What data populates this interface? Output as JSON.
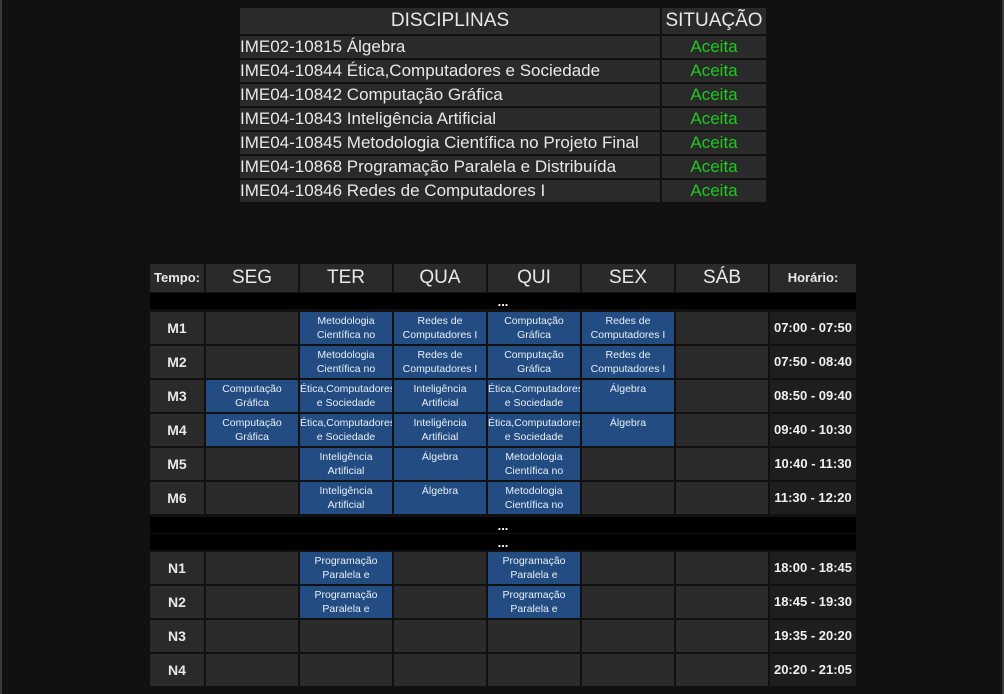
{
  "disciplines": {
    "header_name": "DISCIPLINAS",
    "header_status": "SITUAÇÃO",
    "rows": [
      {
        "name": "IME02-10815 Álgebra",
        "status": "Aceita"
      },
      {
        "name": "IME04-10844 Ética,Computadores e Sociedade",
        "status": "Aceita"
      },
      {
        "name": "IME04-10842 Computação Gráfica",
        "status": "Aceita"
      },
      {
        "name": "IME04-10843 Inteligência Artificial",
        "status": "Aceita"
      },
      {
        "name": "IME04-10845 Metodologia Científica no Projeto Final",
        "status": "Aceita"
      },
      {
        "name": "IME04-10868 Programação Paralela e Distribuída",
        "status": "Aceita"
      },
      {
        "name": "IME04-10846 Redes de Computadores I",
        "status": "Aceita"
      }
    ]
  },
  "schedule": {
    "tempo_label": "Tempo:",
    "horario_label": "Horário:",
    "days": [
      "SEG",
      "TER",
      "QUA",
      "QUI",
      "SEX",
      "SÁB"
    ],
    "gap_label": "...",
    "rows": [
      {
        "label": "M1",
        "time": "07:00 - 07:50",
        "cells": [
          "",
          "Metodologia Científica no",
          "Redes de Computadores I",
          "Computação Gráfica",
          "Redes de Computadores I",
          ""
        ]
      },
      {
        "label": "M2",
        "time": "07:50 - 08:40",
        "cells": [
          "",
          "Metodologia Científica no",
          "Redes de Computadores I",
          "Computação Gráfica",
          "Redes de Computadores I",
          ""
        ]
      },
      {
        "label": "M3",
        "time": "08:50 - 09:40",
        "cells": [
          "Computação Gráfica",
          "Ética,Computadores e Sociedade",
          "Inteligência Artificial",
          "Ética,Computadores e Sociedade",
          "Álgebra",
          ""
        ]
      },
      {
        "label": "M4",
        "time": "09:40 - 10:30",
        "cells": [
          "Computação Gráfica",
          "Ética,Computadores e Sociedade",
          "Inteligência Artificial",
          "Ética,Computadores e Sociedade",
          "Álgebra",
          ""
        ]
      },
      {
        "label": "M5",
        "time": "10:40 - 11:30",
        "cells": [
          "",
          "Inteligência Artificial",
          "Álgebra",
          "Metodologia Científica no",
          "",
          ""
        ]
      },
      {
        "label": "M6",
        "time": "11:30 - 12:20",
        "cells": [
          "",
          "Inteligência Artificial",
          "Álgebra",
          "Metodologia Científica no",
          "",
          ""
        ]
      },
      {
        "label": "N1",
        "time": "18:00 - 18:45",
        "cells": [
          "",
          "Programação Paralela e",
          "",
          "Programação Paralela e",
          "",
          ""
        ]
      },
      {
        "label": "N2",
        "time": "18:45 - 19:30",
        "cells": [
          "",
          "Programação Paralela e",
          "",
          "Programação Paralela e",
          "",
          ""
        ]
      },
      {
        "label": "N3",
        "time": "19:35 - 20:20",
        "cells": [
          "",
          "",
          "",
          "",
          "",
          ""
        ]
      },
      {
        "label": "N4",
        "time": "20:20 - 21:05",
        "cells": [
          "",
          "",
          "",
          "",
          "",
          ""
        ]
      }
    ]
  },
  "colors": {
    "accepted": "#1ec81e",
    "class_block": "#234d82",
    "background": "#111111"
  }
}
